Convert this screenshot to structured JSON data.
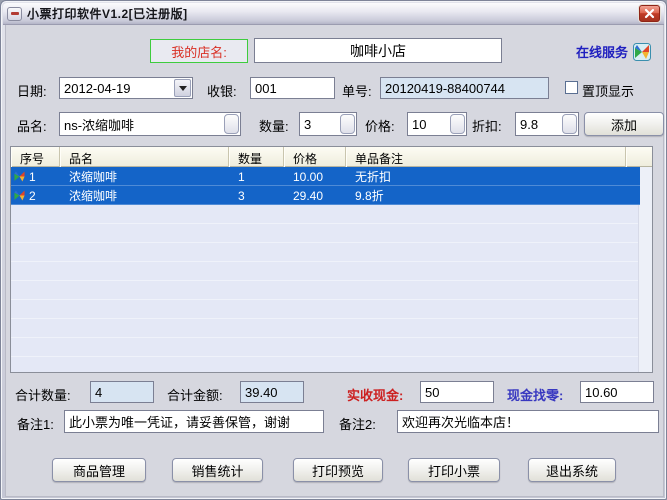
{
  "window": {
    "title": "小票打印软件V1.2[已注册版]"
  },
  "header": {
    "shop_label": "我的店名:",
    "shop_name": "咖啡小店",
    "online_service": "在线服务"
  },
  "order_row": {
    "date_label": "日期:",
    "date_value": "2012-04-19",
    "cashier_label": "收银:",
    "cashier_value": "001",
    "order_no_label": "单号:",
    "order_no_value": "20120419-88400744",
    "topmost_label": "置顶显示"
  },
  "item_row": {
    "product_label": "品名:",
    "product_value": "ns-浓缩咖啡",
    "qty_label": "数量:",
    "qty_value": "3",
    "price_label": "价格:",
    "price_value": "10",
    "discount_label": "折扣:",
    "discount_value": "9.8",
    "add_button": "添加"
  },
  "table": {
    "columns": [
      "序号",
      "品名",
      "数量",
      "价格",
      "单品备注"
    ],
    "rows": [
      {
        "no": "1",
        "name": "浓缩咖啡",
        "qty": "1",
        "price": "10.00",
        "note": "无折扣"
      },
      {
        "no": "2",
        "name": "浓缩咖啡",
        "qty": "3",
        "price": "29.40",
        "note": "9.8折"
      }
    ]
  },
  "totals": {
    "total_qty_label": "合计数量:",
    "total_qty_value": "4",
    "total_amount_label": "合计金额:",
    "total_amount_value": "39.40",
    "cash_label": "实收现金:",
    "cash_value": "50",
    "change_label": "现金找零:",
    "change_value": "10.60"
  },
  "notes": {
    "note1_label": "备注1:",
    "note1_value": "此小票为唯一凭证，请妥善保管，谢谢",
    "note2_label": "备注2:",
    "note2_value": "欢迎再次光临本店！"
  },
  "footer_buttons": [
    "商品管理",
    "销售统计",
    "打印预览",
    "打印小票",
    "退出系统"
  ],
  "colors": {
    "selection-blue": "#1464C8",
    "readonly-field-bg": "#D7E4F2",
    "shop-label-red": "#D93025",
    "shop-label-border": "#3ECC3E",
    "link-blue": "#1F1FBF",
    "cash-label-red": "#CC2020",
    "change-label-blue": "#3838C0",
    "close-red": "#C23C26"
  }
}
